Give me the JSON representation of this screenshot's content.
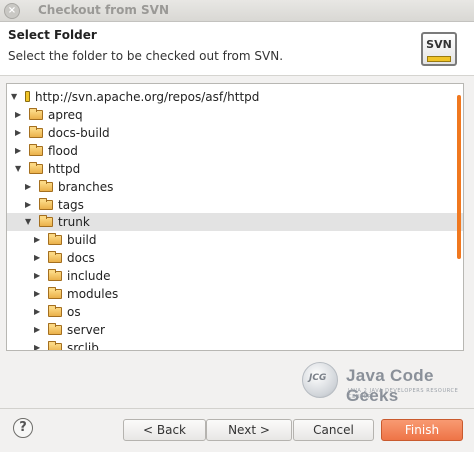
{
  "window": {
    "title": "Checkout from SVN"
  },
  "header": {
    "title": "Select Folder",
    "description": "Select the folder to be checked out from SVN.",
    "logo_text": "SVN"
  },
  "tree": {
    "root": "http://svn.apache.org/repos/asf/httpd",
    "items": [
      {
        "label": "apreq",
        "level": 1,
        "expanded": false
      },
      {
        "label": "docs-build",
        "level": 1,
        "expanded": false
      },
      {
        "label": "flood",
        "level": 1,
        "expanded": false
      },
      {
        "label": "httpd",
        "level": 1,
        "expanded": true
      },
      {
        "label": "branches",
        "level": 2,
        "expanded": false
      },
      {
        "label": "tags",
        "level": 2,
        "expanded": false
      },
      {
        "label": "trunk",
        "level": 2,
        "expanded": true,
        "selected": true
      },
      {
        "label": "build",
        "level": 3,
        "expanded": false
      },
      {
        "label": "docs",
        "level": 3,
        "expanded": false
      },
      {
        "label": "include",
        "level": 3,
        "expanded": false
      },
      {
        "label": "modules",
        "level": 3,
        "expanded": false
      },
      {
        "label": "os",
        "level": 3,
        "expanded": false
      },
      {
        "label": "server",
        "level": 3,
        "expanded": false
      },
      {
        "label": "srclib",
        "level": 3,
        "expanded": false
      }
    ]
  },
  "watermark": {
    "circle_text": "JCG",
    "name": "Java Code Geeks",
    "tagline": "JAVA 2 JAVA DEVELOPERS RESOURCE CENTER"
  },
  "buttons": {
    "help": "?",
    "back": "< Back",
    "next": "Next >",
    "cancel": "Cancel",
    "finish": "Finish"
  },
  "colors": {
    "accent": "#ee7447",
    "scrollbar": "#f0781f",
    "selection": "#e3e3e3"
  }
}
